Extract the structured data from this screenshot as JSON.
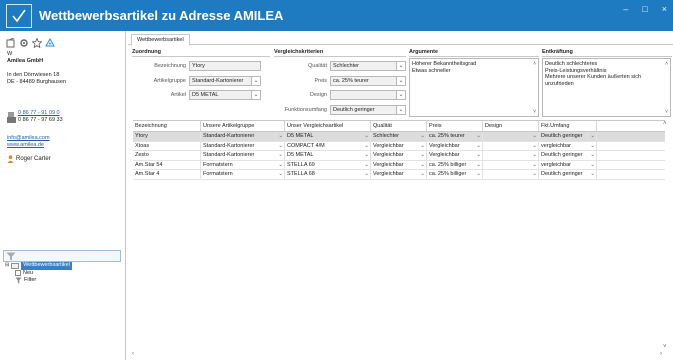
{
  "window": {
    "title": "Wettbewerbsartikel zu Adresse AMILEA",
    "accent": "#1f7bc1",
    "minimize_glyph": "–",
    "maximize_glyph": "□",
    "close_glyph": "×"
  },
  "sidebar": {
    "address": {
      "line0": "W",
      "company": "Amilea GmbH",
      "street": "In den Dörrwiesen 18",
      "city": "DE - 84489 Burghausen"
    },
    "phone": "0 86 77 - 91 09 0",
    "fax": "0 86 77 - 97 69 33",
    "email": "info@amilea.com",
    "website": "www.amilea.de",
    "contact_person": "Roger Carter",
    "search": {
      "value": "",
      "placeholder": ""
    },
    "tree": {
      "root": "Wettbewerbsartikel",
      "children": [
        "Neu",
        "Filter"
      ]
    }
  },
  "main": {
    "tab_label": "Wettbewerbsartikel",
    "zuordnung": {
      "title": "Zuordnung",
      "bezeichnung_label": "Bezeichnung",
      "bezeichnung_value": "Ytory",
      "artikelgruppe_label": "Artikelgruppe",
      "artikelgruppe_value": "Standard-Kartonierer",
      "artikel_label": "Artikel",
      "artikel_value": "D5 METAL"
    },
    "vergleich": {
      "title": "Vergleichskriterien",
      "qualitaet_label": "Qualität",
      "qualitaet_value": "Schlechter",
      "preis_label": "Preis",
      "preis_value": "ca. 25% teurer",
      "design_label": "Design",
      "design_value": "",
      "funktion_label": "Funktionsumfang",
      "funktion_value": "Deutlich geringer"
    },
    "argumente": {
      "title": "Argumente",
      "lines": [
        "Höherer Bekanntheitsgrad",
        "Etwas schneller"
      ]
    },
    "entkraeftung": {
      "title": "Entkräftung",
      "lines": [
        "Deutlich schlechteres",
        "Preis-Leistungsverhältnis",
        "Mehrere unserer Kunden äußerten sich",
        "unzufrieden"
      ]
    },
    "grid": {
      "headers": [
        "Bezeichnung",
        "Unsere Artikelgruppe",
        "Unser Vergleichsartikel",
        "Qualität",
        "Preis",
        "Design",
        "Fkt.Umfang"
      ],
      "rows": [
        [
          "Ytory",
          "Standard-Kartonierer",
          "D5 METAL",
          "Schlechter",
          "ca. 25% teurer",
          "",
          "Deutlich geringer"
        ],
        [
          "Xtoas",
          "Standard-Kartonierer",
          "COMPACT 4/M",
          "Vergleichbar",
          "Vergleichbar",
          "",
          "vergleichbar"
        ],
        [
          "Zesto",
          "Standard-Kartonierer",
          "D5 METAL",
          "Vergleichbar",
          "Vergleichbar",
          "",
          "Deutlich geringer"
        ],
        [
          "Am.Star 54",
          "Formatstern",
          "STELLA 69",
          "Vergleichbar",
          "ca. 25% billiger",
          "",
          "vergleichbar"
        ],
        [
          "Am.Star 4",
          "Formatstern",
          "STELLA  68",
          "Vergleichbar",
          "ca. 25% billiger",
          "",
          "Deutlich geringer"
        ]
      ]
    }
  }
}
